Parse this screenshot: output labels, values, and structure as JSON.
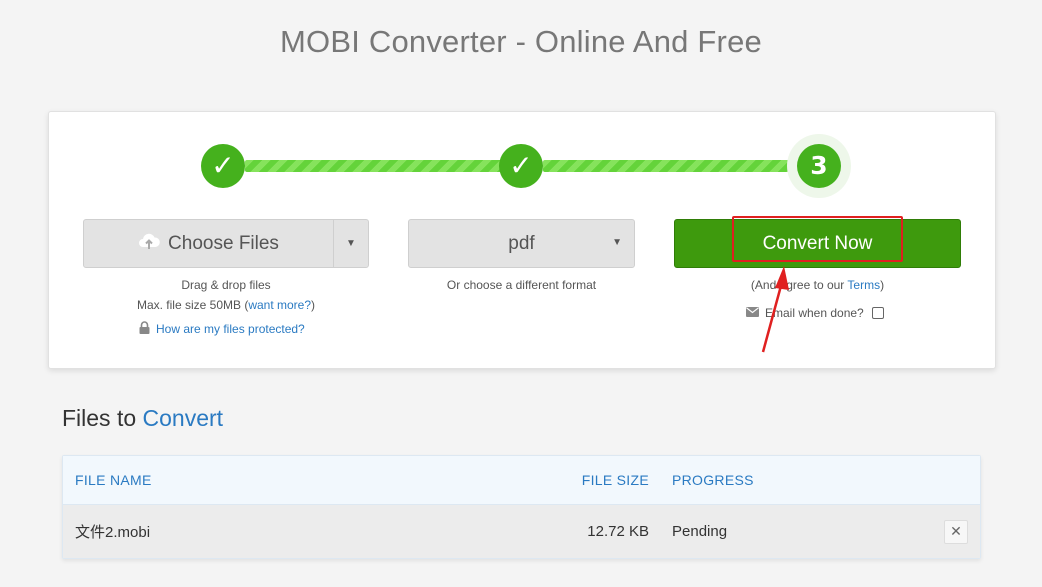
{
  "page": {
    "title": "MOBI Converter - Online And Free"
  },
  "steps": {
    "step1_mark": "✓",
    "step2_mark": "✓",
    "step3_number": "3"
  },
  "upload": {
    "choose_files_label": "Choose Files",
    "icon": "cloud-upload-icon",
    "drag_hint": "Drag & drop files",
    "max_size_text": "Max. file size 50MB (",
    "want_more_link": "want more?",
    "max_size_close": ")",
    "protect_link": "How are my files protected?"
  },
  "format": {
    "selected": "pdf",
    "hint": "Or choose a different format"
  },
  "convert": {
    "button_label": "Convert Now",
    "agree_prefix": "(And agree to our ",
    "terms_link": "Terms",
    "agree_suffix": ")",
    "email_label": "Email when done?"
  },
  "files": {
    "heading_prefix": "Files to ",
    "heading_accent": "Convert",
    "columns": {
      "name": "FILE NAME",
      "size": "FILE SIZE",
      "progress": "PROGRESS"
    },
    "rows": [
      {
        "name": "文件2.mobi",
        "size": "12.72 KB",
        "progress": "Pending",
        "remove": "✕"
      }
    ]
  },
  "colors": {
    "accent_green": "#3e9a0d",
    "step_green": "#45b11d",
    "link_blue": "#2a7ac2",
    "annotation_red": "#e02020"
  }
}
